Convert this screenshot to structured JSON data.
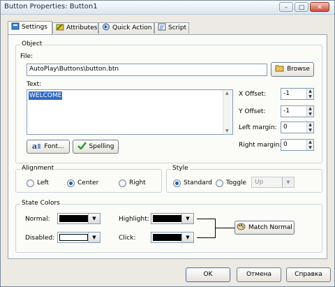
{
  "window": {
    "title": "Button Properties: Button1"
  },
  "titlebar_buttons": [
    "minimize-icon",
    "maximize-icon",
    "close-icon"
  ],
  "tabs": [
    {
      "label": "Settings",
      "icon": "settings-icon",
      "active": true
    },
    {
      "label": "Attributes",
      "icon": "attributes-icon",
      "active": false
    },
    {
      "label": "Quick Action",
      "icon": "quick-action-icon",
      "active": false
    },
    {
      "label": "Script",
      "icon": "script-icon",
      "active": false
    }
  ],
  "object": {
    "legend": "Object",
    "file_label": "File:",
    "file_value": "AutoPlay\\Buttons\\button.btn",
    "browse_label": "Browse",
    "text_label": "Text:",
    "text_value": "WELCOME",
    "x_offset_label": "X Offset:",
    "x_offset_value": "-1",
    "y_offset_label": "Y Offset:",
    "y_offset_value": "-1",
    "left_margin_label": "Left margin:",
    "left_margin_value": "0",
    "right_margin_label": "Right margin:",
    "right_margin_value": "0",
    "font_label": "Font...",
    "spelling_label": "Spelling"
  },
  "alignment": {
    "legend": "Alignment",
    "options": [
      {
        "label": "Left",
        "selected": false
      },
      {
        "label": "Center",
        "selected": true
      },
      {
        "label": "Right",
        "selected": false
      }
    ]
  },
  "style": {
    "legend": "Style",
    "standard_label": "Standard",
    "standard_selected": true,
    "toggle_label": "Toggle",
    "toggle_selected": false,
    "toggle_state_value": "Up"
  },
  "state_colors": {
    "legend": "State Colors",
    "normal_label": "Normal:",
    "normal_color": "#000000",
    "disabled_label": "Disabled:",
    "disabled_color": "#ffffff",
    "highlight_label": "Highlight:",
    "highlight_color": "#000000",
    "click_label": "Click:",
    "click_color": "#000000",
    "match_normal_label": "Match Normal"
  },
  "footer": {
    "ok_label": "OK",
    "cancel_label": "Отмена",
    "help_label": "Справка"
  },
  "colors": {
    "selection": "#316ac5",
    "accent": "#1f5fb5"
  }
}
